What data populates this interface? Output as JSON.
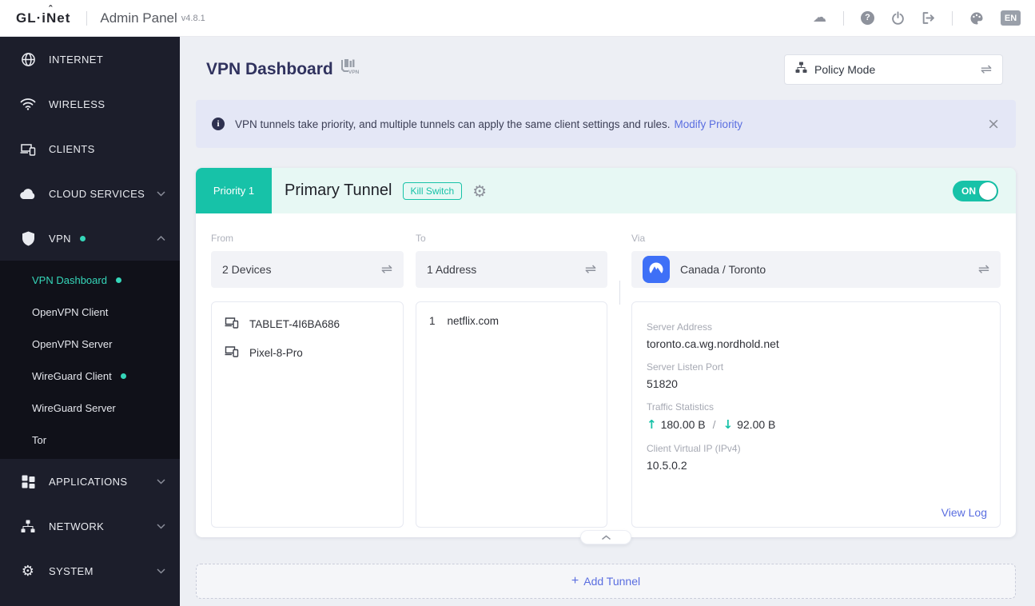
{
  "header": {
    "logo": "GL·iNet",
    "logo_hat": "ˆ",
    "app_title": "Admin Panel",
    "version": "v4.8.1",
    "language": "EN"
  },
  "icons": {
    "swap": "⇌",
    "gear": "⚙",
    "close": "×",
    "help": "?",
    "info": "i",
    "plus": "+",
    "up_arrow": "↑",
    "down_arrow": "↓"
  },
  "colors": {
    "accent_teal": "#17c2a8",
    "active_teal": "#35d6b9",
    "link_blue": "#5a6ee0",
    "sidebar_bg": "#1c1e2b",
    "banner_bg": "#e4e7f6",
    "nordvpn_blue": "#3e70f7"
  },
  "sidebar": {
    "items": [
      {
        "label": "INTERNET"
      },
      {
        "label": "WIRELESS"
      },
      {
        "label": "CLIENTS"
      },
      {
        "label": "CLOUD SERVICES"
      },
      {
        "label": "VPN"
      }
    ],
    "vpn_submenu": [
      {
        "label": "VPN Dashboard"
      },
      {
        "label": "OpenVPN Client"
      },
      {
        "label": "OpenVPN Server"
      },
      {
        "label": "WireGuard Client"
      },
      {
        "label": "WireGuard Server"
      },
      {
        "label": "Tor"
      }
    ],
    "items_bottom": [
      {
        "label": "APPLICATIONS"
      },
      {
        "label": "NETWORK"
      },
      {
        "label": "SYSTEM"
      }
    ]
  },
  "page": {
    "title": "VPN Dashboard",
    "mode_select": "Policy Mode",
    "banner_text": "VPN tunnels take priority, and multiple tunnels can apply the same client settings and rules.",
    "banner_link": "Modify Priority"
  },
  "tunnel": {
    "priority_badge": "Priority 1",
    "name": "Primary Tunnel",
    "kill_switch": "Kill Switch",
    "toggle_state": "ON",
    "from": {
      "label": "From",
      "value": "2 Devices",
      "devices": [
        "TABLET-4I6BA686",
        "Pixel-8-Pro"
      ]
    },
    "to": {
      "label": "To",
      "value": "1 Address",
      "addresses": [
        {
          "index": "1",
          "host": "netflix.com"
        }
      ]
    },
    "via": {
      "label": "Via",
      "value": "Canada / Toronto",
      "details": {
        "server_address_label": "Server Address",
        "server_address": "toronto.ca.wg.nordhold.net",
        "listen_port_label": "Server Listen Port",
        "listen_port": "51820",
        "traffic_label": "Traffic Statistics",
        "upload": "180.00 B",
        "traffic_separator": "/",
        "download": "92.00 B",
        "client_ip_label": "Client Virtual IP (IPv4)",
        "client_ip": "10.5.0.2",
        "view_log": "View Log"
      }
    }
  },
  "add_tunnel_label": "Add Tunnel"
}
